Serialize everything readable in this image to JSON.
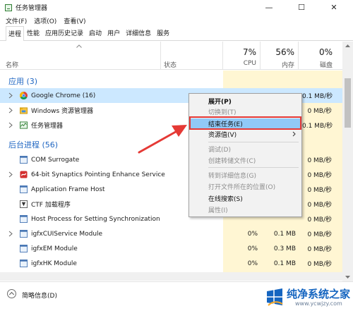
{
  "window": {
    "title": "任务管理器",
    "minimize": "—",
    "maximize": "☐",
    "close": "✕"
  },
  "menu": {
    "items": [
      "文件(F)",
      "选项(O)",
      "查看(V)"
    ]
  },
  "tabs": [
    "进程",
    "性能",
    "应用历史记录",
    "启动",
    "用户",
    "详细信息",
    "服务"
  ],
  "columns": {
    "name": "名称",
    "status": "状态",
    "cpu": {
      "pct": "7%",
      "label": "CPU"
    },
    "memory": {
      "pct": "56%",
      "label": "内存"
    },
    "disk": {
      "pct": "0%",
      "label": "磁盘"
    }
  },
  "groups": {
    "apps": "应用 (3)",
    "background": "后台进程 (56)"
  },
  "apps": [
    {
      "name": "Google Chrome (16)",
      "disk": "0.1 MB/秒",
      "icon": "chrome-icon"
    },
    {
      "name": "Windows 资源管理器",
      "disk": "0 MB/秒",
      "icon": "explorer-icon"
    },
    {
      "name": "任务管理器",
      "disk": "0.1 MB/秒",
      "icon": "taskmgr-icon"
    }
  ],
  "background": [
    {
      "name": "COM Surrogate",
      "cpu": "",
      "memory": "",
      "disk": "0 MB/秒"
    },
    {
      "name": "64-bit Synaptics Pointing Enhance Service",
      "cpu": "",
      "memory": "",
      "disk": "0 MB/秒"
    },
    {
      "name": "Application Frame Host",
      "cpu": "",
      "memory": "",
      "disk": "0 MB/秒"
    },
    {
      "name": "CTF 加载程序",
      "cpu": "",
      "memory": "",
      "disk": "0 MB/秒"
    },
    {
      "name": "Host Process for Setting Synchronization",
      "cpu": "",
      "memory": "",
      "disk": "0 MB/秒"
    },
    {
      "name": "igfxCUIService Module",
      "cpu": "0%",
      "memory": "0.1 MB",
      "disk": "0 MB/秒"
    },
    {
      "name": "igfxEM Module",
      "cpu": "0%",
      "memory": "0.3 MB",
      "disk": "0 MB/秒"
    },
    {
      "name": "igfxHK Module",
      "cpu": "0%",
      "memory": "0.1 MB",
      "disk": "0 MB/秒"
    }
  ],
  "context_menu": {
    "items": [
      {
        "label": "展开(P)",
        "state": "bold"
      },
      {
        "label": "切换到(T)",
        "state": "disabled"
      },
      {
        "label": "结束任务(E)",
        "state": "highlighted"
      },
      {
        "label": "资源值(V)",
        "state": "normal"
      },
      {
        "label": "调试(D)",
        "state": "disabled"
      },
      {
        "label": "创建转储文件(C)",
        "state": "disabled"
      },
      {
        "label": "转到详细信息(G)",
        "state": "disabled"
      },
      {
        "label": "打开文件所在的位置(O)",
        "state": "disabled"
      },
      {
        "label": "在线搜索(S)",
        "state": "normal"
      },
      {
        "label": "属性(I)",
        "state": "disabled"
      }
    ]
  },
  "footer": {
    "fewer_details": "简略信息(D)"
  },
  "watermark": {
    "title": "纯净系统之家",
    "url": "www.ycwjzy.com"
  },
  "colors": {
    "selected_row": "#cce8ff",
    "heat_column": "#fff6d3",
    "group_blue": "#1f66c2",
    "annotation_red": "#e53935"
  }
}
